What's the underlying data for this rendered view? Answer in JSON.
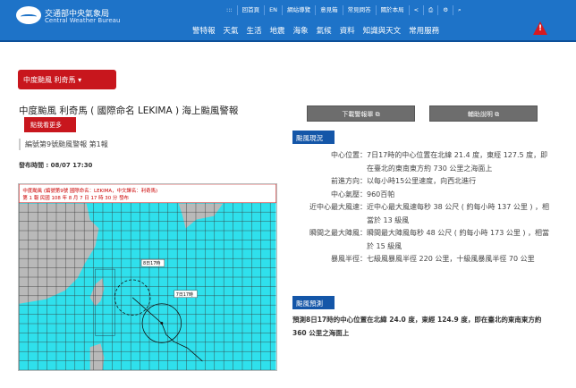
{
  "header": {
    "org_zh": "交通部中央氣象局",
    "org_en": "Central Weather Bureau",
    "top_links": [
      ":::",
      "回首頁",
      "EN",
      "網站導覽",
      "意見箱",
      "常見問答",
      "關於本局",
      "<",
      "⎙",
      "⚙",
      "⌕"
    ],
    "nav": [
      "警特報",
      "天氣",
      "生活",
      "地震",
      "海象",
      "氣候",
      "資料",
      "知識與天文",
      "常用服務"
    ],
    "warning_icon": "!"
  },
  "typhoon_select": {
    "label": "中度颱風 利奇馬 ▾"
  },
  "title": "中度颱風 利奇馬 ( 國際命名 LEKIMA ) 海上颱風警報",
  "more_button": "點我看更多",
  "report_no": "編號第9號颱風警報 第1報",
  "publish": "發布時間 : 08/07 17:30",
  "buttons": {
    "download": "下載警報單 ⧉",
    "help": "輔助說明 ⧉"
  },
  "current": {
    "heading": "颱風現況",
    "rows": [
      {
        "k": "中心位置：",
        "v": "7日17時的中心位置在北緯 21.4 度，東經 127.5 度，即在臺北的東南東方約 730 公里之海面上"
      },
      {
        "k": "前進方向：",
        "v": "以每小時15公里速度，向西北進行"
      },
      {
        "k": "中心氣壓：",
        "v": "960百帕"
      },
      {
        "k": "近中心最大風速：",
        "v": "近中心最大風速每秒 38 公尺 ( 約每小時 137 公里 ) ，相當於 13 級風"
      },
      {
        "k": "瞬間之最大陣風：",
        "v": "瞬間最大陣風每秒 48 公尺 ( 約每小時 173 公里 ) ，相當於 15 級風"
      },
      {
        "k": "暴風半徑：",
        "v": "七級風暴風半徑 220 公里，十級風暴風半徑 70 公里"
      }
    ]
  },
  "forecast": {
    "heading": "颱風預測",
    "text": "預測8日17時的中心位置在北緯 24.0 度，東經 124.9 度，即在臺北的東南東方約 360 公里之海面上"
  },
  "map": {
    "line1": "中度颱風 (編號第9號 國際命名：LEKIMA，中文譯名：利奇馬)",
    "line2": "第 1 報 民國 108 年 8 月 7 日 17 時 30 分 發布",
    "label_now": "7日17時",
    "label_fc": "8日17時"
  }
}
